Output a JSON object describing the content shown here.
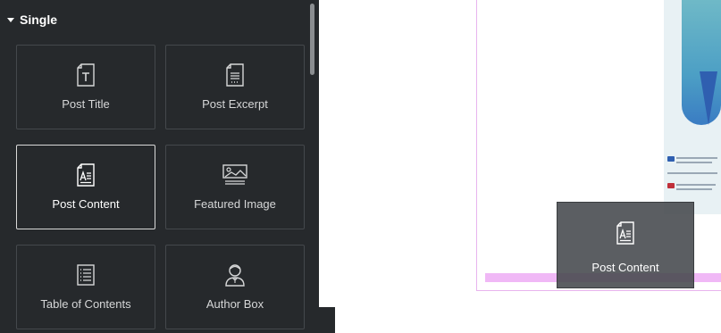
{
  "panel": {
    "section_title": "Single",
    "widgets": [
      {
        "label": "Post Title",
        "icon": "post-title-icon"
      },
      {
        "label": "Post Excerpt",
        "icon": "post-excerpt-icon"
      },
      {
        "label": "Post Content",
        "icon": "post-content-icon",
        "selected": true
      },
      {
        "label": "Featured Image",
        "icon": "featured-image-icon"
      },
      {
        "label": "Table of Contents",
        "icon": "table-of-contents-icon"
      },
      {
        "label": "Author Box",
        "icon": "author-box-icon"
      }
    ]
  },
  "drag_ghost": {
    "label": "Post Content",
    "icon": "post-content-icon"
  },
  "colors": {
    "panel_bg": "#26292c",
    "tile_border": "#44484c",
    "selected_border": "#d9d9d9",
    "drop_indicator": "#f0b8f6"
  }
}
